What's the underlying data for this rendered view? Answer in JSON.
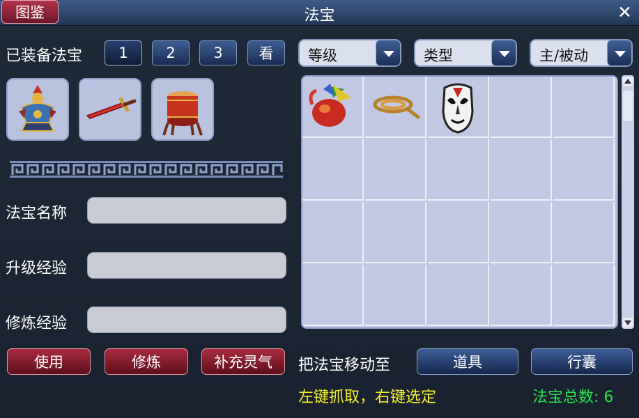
{
  "window": {
    "title": "法宝",
    "tujian_label": "图鉴",
    "close_glyph": "✕"
  },
  "equip": {
    "label": "已装备法宝",
    "tabs": [
      "1",
      "2",
      "3"
    ],
    "view_label": "看"
  },
  "filters": {
    "level": "等级",
    "type": "类型",
    "mode": "主/被动"
  },
  "equipped_icons": [
    "armored-figure-icon",
    "red-sword-icon",
    "red-drum-icon"
  ],
  "fields": {
    "name_label": "法宝名称",
    "upgrade_label": "升级经验",
    "cultivate_label": "修炼经验"
  },
  "actions": {
    "use": "使用",
    "cultivate": "修炼",
    "recharge": "补充灵气"
  },
  "move": {
    "label": "把法宝移动至",
    "items": "道具",
    "bag": "行囊"
  },
  "hint": "左键抓取，右键选定",
  "total": "法宝总数: 6",
  "inventory_icons": [
    "flag-gourd-icon",
    "coiled-rope-icon",
    "opera-mask-icon"
  ],
  "colors": {
    "hint": "#f3ee2a",
    "total": "#26e04e",
    "accent_red": "#a82c3e",
    "accent_blue": "#3b5d97"
  }
}
